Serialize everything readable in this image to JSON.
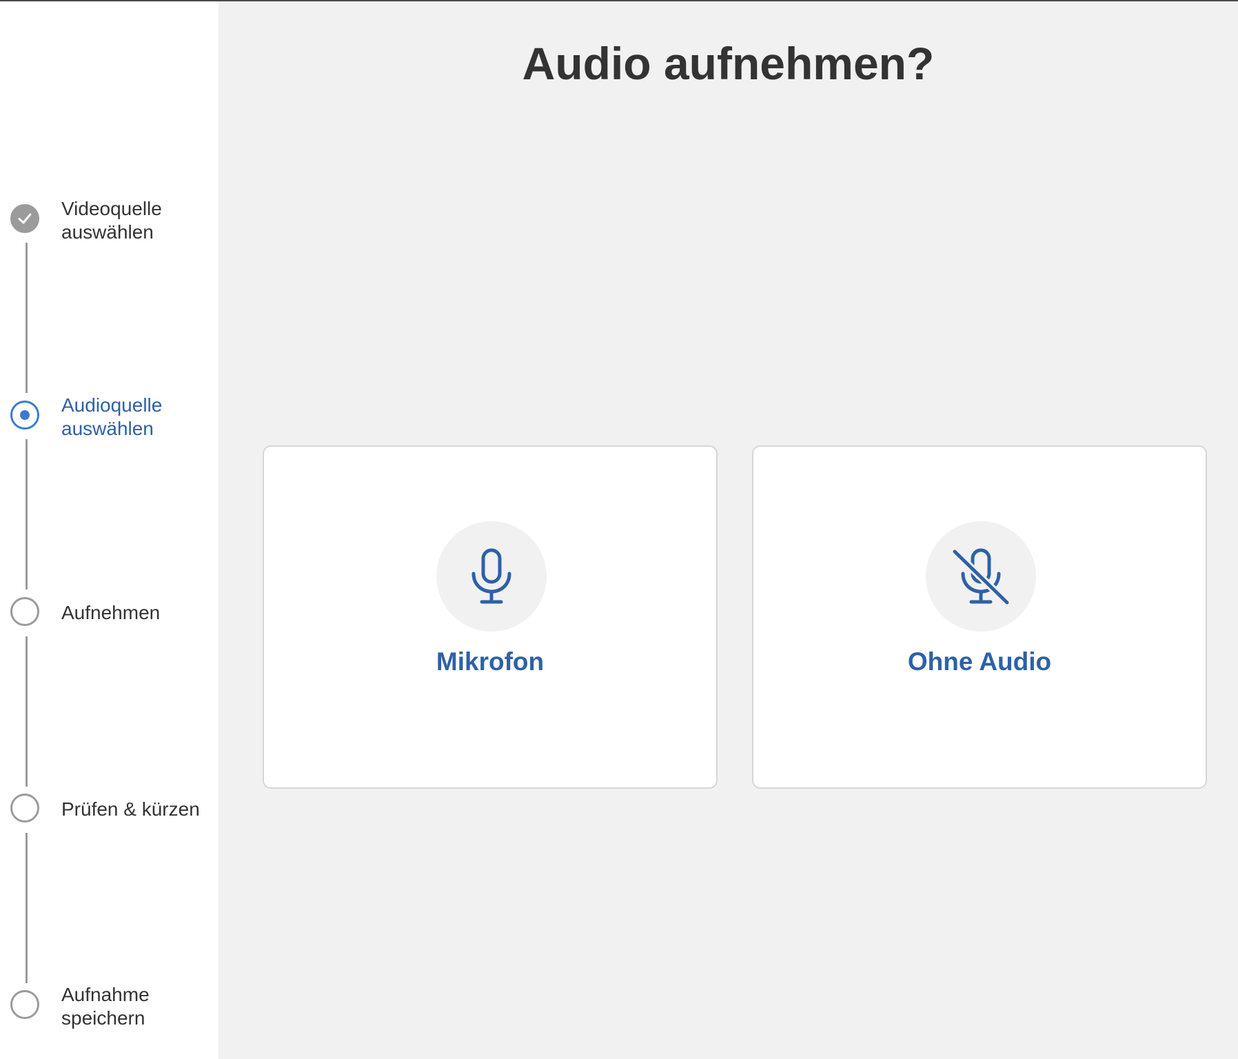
{
  "page": {
    "title": "Audio aufnehmen?"
  },
  "steps": [
    {
      "label": "Videoquelle\nauswählen",
      "state": "done"
    },
    {
      "label": "Audioquelle\nauswählen",
      "state": "active"
    },
    {
      "label": "Aufnehmen",
      "state": "pending"
    },
    {
      "label": "Prüfen & kürzen",
      "state": "pending"
    },
    {
      "label": "Aufnahme\nspeichern",
      "state": "pending"
    }
  ],
  "options": [
    {
      "label": "Mikrofon",
      "icon": "microphone-icon"
    },
    {
      "label": "Ohne Audio",
      "icon": "microphone-off-icon"
    }
  ],
  "colors": {
    "accent": "#2e61a5",
    "active_step": "#3a7bd0",
    "inactive_step": "#9b9b9b",
    "text": "#333333",
    "background": "#f1f1f1"
  }
}
